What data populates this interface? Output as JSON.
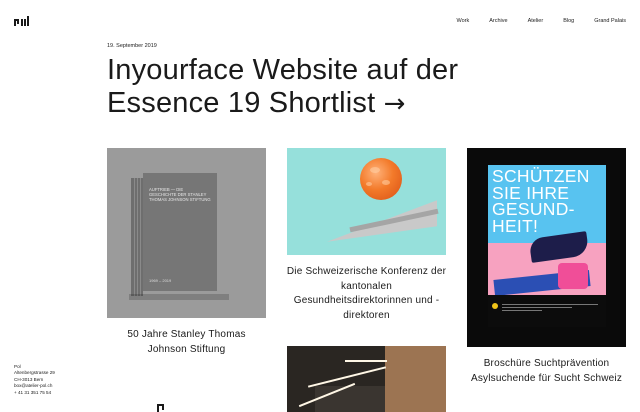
{
  "brand": {
    "logo_text": "pol"
  },
  "nav": {
    "items": [
      {
        "label": "Work"
      },
      {
        "label": "Archive"
      },
      {
        "label": "Atelier"
      },
      {
        "label": "Blog"
      },
      {
        "label": "Grand Palais"
      }
    ]
  },
  "post": {
    "date": "19. September 2019",
    "title": "Inyourface Website auf der Essence 19 Shortlist",
    "title_arrow": "→"
  },
  "cards": [
    {
      "caption": "50 Jahre Stanley Thomas Johnson Stiftung",
      "image_text": "AUFTRIEB — DIE GESCHICHTE DER STANLEY THOMAS JOHNSON STIFTUNG",
      "image_foot": "1969 – 2019"
    },
    {
      "caption": "Die Schweizerische Konferenz der kantonalen Gesundheitsdirektorinnen und -direktoren"
    },
    {
      "caption": "Broschüre Suchtprävention Asylsuchende für Sucht Schweiz",
      "poster_text": "SCHÜTZEN SIE IHRE GESUND-HEIT!"
    },
    {
      "caption": ""
    }
  ],
  "footer": {
    "lines": [
      "Pol",
      "Altenbergstrasse 29",
      "CH-3013 Bern",
      "box@atelier-pol.ch",
      "+ 41 31 351 75 54"
    ]
  },
  "colors": {
    "background": "#ffffff",
    "text": "#1a1a1a",
    "teal": "#96e0db",
    "poster_blue": "#58c3f0"
  }
}
